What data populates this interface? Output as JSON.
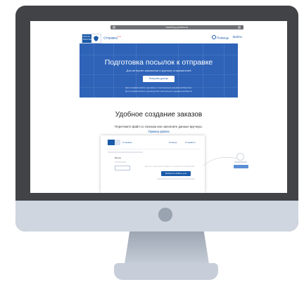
{
  "browser": {
    "url": "tracking.pochta.ru"
  },
  "nav": {
    "logo_text_1": "ПОЧТА",
    "logo_text_2": "РОССИИ",
    "brand": "Отправка",
    "brand_badge": "beta",
    "help": "Помощь",
    "login": "Войти"
  },
  "hero": {
    "title": "Подготовка посылок к отправке",
    "subtitle": "Для интернет-магазинов и крупных отправителей",
    "button": "Получить доступ",
    "note_line1": "Для отправителей по договору с электронным документооборотом.",
    "note_line2": "Для отправителей по договору без электронного документооборота"
  },
  "section": {
    "title": "Удобное создание заказов",
    "subtitle": "Перетяните файл со списком или заполните данные вручную.",
    "link": "Пример файла"
  },
  "preview": {
    "brand": "Отправка",
    "help": "Помощь",
    "login": "Отправить",
    "label": "Выбор",
    "drop_text": "Просто перетяните файл со списком отправлений",
    "cta": "Выберите файлы для загрузки"
  },
  "colors": {
    "primary": "#1a5aa8",
    "hero": "#2e63b8",
    "bezel": "#414346"
  }
}
